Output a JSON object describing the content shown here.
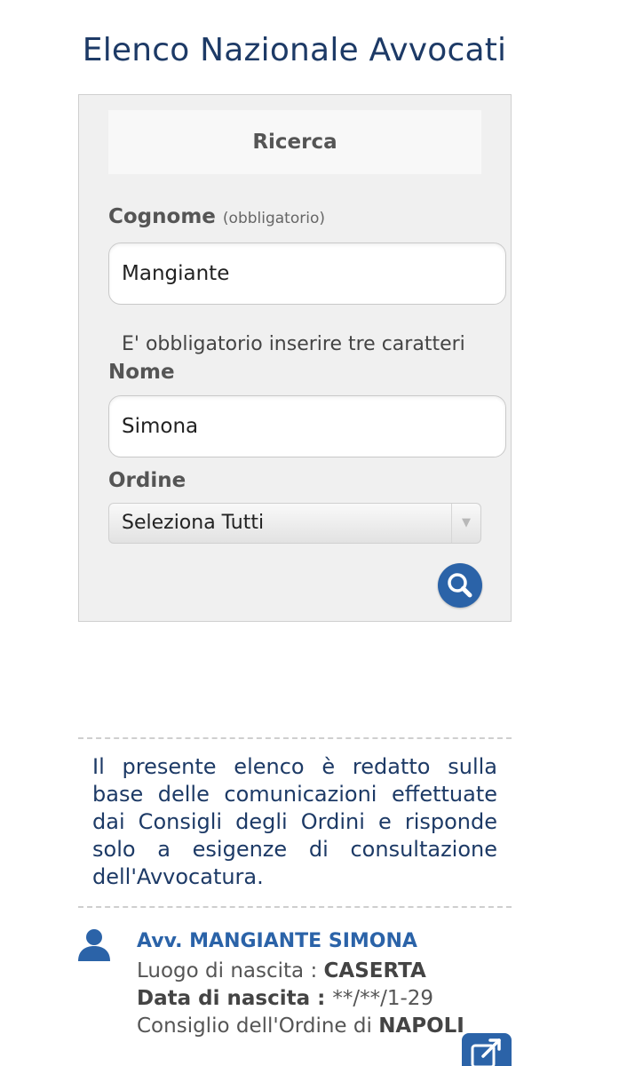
{
  "header": {
    "title": "Elenco Nazionale Avvocati"
  },
  "search_form": {
    "heading": "Ricerca",
    "cognome_label": "Cognome",
    "cognome_hint": "(obbligatorio)",
    "cognome_value": "Mangiante",
    "required_message": "E' obbligatorio inserire tre caratteri",
    "nome_label": "Nome",
    "nome_value": "Simona",
    "ordine_label": "Ordine",
    "ordine_selected": "Seleziona Tutti",
    "search_button_icon": "search-icon"
  },
  "disclaimer": {
    "text": "Il presente elenco è redatto sulla base delle comunicazioni effettuate dai Consigli degli Ordini e risponde solo a esigenze di consultazione dell'Avvocatura."
  },
  "result": {
    "icon": "person-icon",
    "name": "Avv. MANGIANTE SIMONA",
    "birthplace_label": "Luogo di nascita : ",
    "birthplace_value": "CASERTA",
    "birthdate_label": "Data di nascita : ",
    "birthdate_value": "**/**/1-29",
    "council_label": "Consiglio dell'Ordine di ",
    "council_value": "NAPOLI",
    "open_icon": "external-link-icon"
  },
  "colors": {
    "title": "#1d3a66",
    "accent": "#2b63a8",
    "panel_bg": "#f0f0f0"
  }
}
